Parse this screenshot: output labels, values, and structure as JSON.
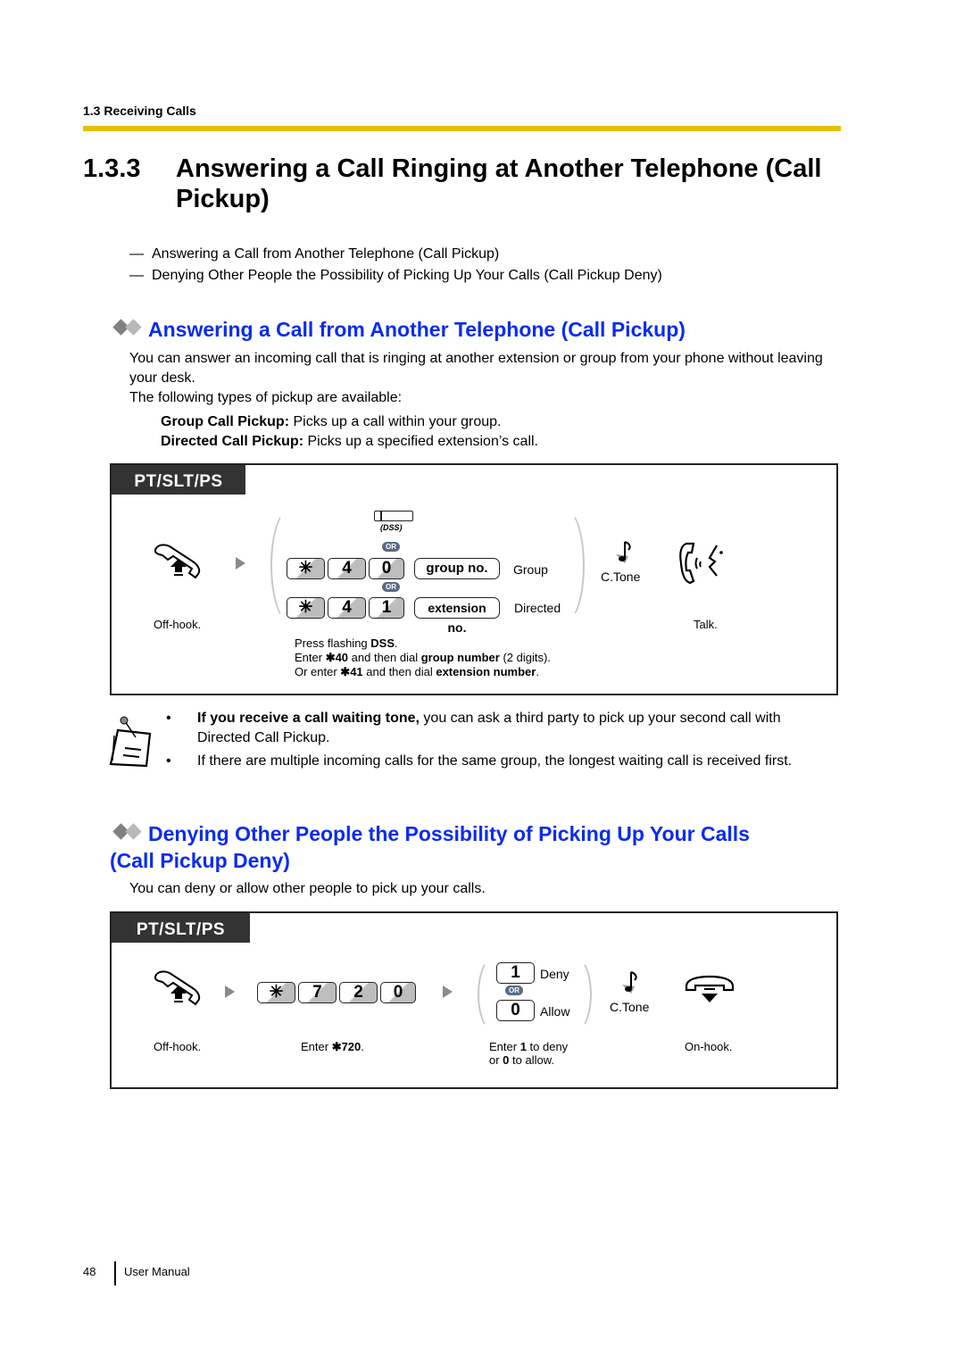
{
  "header": {
    "running_head": "1.3 Receiving Calls",
    "rule_color": "#e6c000"
  },
  "title": {
    "number": "1.3.3",
    "text": "Answering a Call Ringing at Another Telephone (Call Pickup)"
  },
  "toc": [
    "Answering a Call from Another Telephone (Call Pickup)",
    "Denying Other People the Possibility of Picking Up Your Calls (Call Pickup Deny)"
  ],
  "dash": "—",
  "heading_color": "#0a2cf0",
  "section1": {
    "heading": "Answering a Call from Another Telephone (Call Pickup)",
    "intro_1": "You can answer an incoming call that is ringing at another extension or group from your phone without leaving your desk.",
    "intro_2": "The following types of pickup are available:",
    "types": [
      {
        "term": "Group Call Pickup:",
        "desc": " Picks up a call within your group."
      },
      {
        "term": "Directed Call Pickup:",
        "desc": " Picks up a specified extension’s call."
      }
    ],
    "panel": {
      "tab": "PT/SLT/PS",
      "offhook_label": "Off-hook.",
      "dss_label": "(DSS)",
      "or": "OR",
      "row1_keys": [
        "✳",
        "4",
        "0"
      ],
      "row1_pill": "group no.",
      "row1_label": "Group",
      "row2_keys": [
        "✳",
        "4",
        "1"
      ],
      "row2_pill": "extension no.",
      "row2_label": "Directed",
      "ctone": "C.Tone",
      "talk": "Talk.",
      "instructions": {
        "line1_pre": "Press flashing ",
        "line1_bold": "DSS",
        "line1_post": ".",
        "line2_pre": "Enter ",
        "line2_code": "✱40",
        "line2_mid": " and then dial ",
        "line2_bold": "group number",
        "line2_post": " (2 digits).",
        "line3_pre": "Or enter ",
        "line3_code": "✱41",
        "line3_mid": " and then dial ",
        "line3_bold": "extension number",
        "line3_post": "."
      }
    },
    "notes": [
      {
        "bold": "If you receive a call waiting tone,",
        "text": " you can ask a third party to pick up your second call with Directed Call Pickup."
      },
      {
        "bold": "",
        "text": "If there are multiple incoming calls for the same group, the longest waiting call is received first."
      }
    ],
    "bullet": "•"
  },
  "section2": {
    "heading_line1": "Denying Other People the Possibility of Picking Up Your Calls",
    "heading_line2": "(Call Pickup Deny)",
    "intro": "You can deny or allow other people to pick up your calls.",
    "panel": {
      "tab": "PT/SLT/PS",
      "offhook_label": "Off-hook.",
      "keys": [
        "✳",
        "7",
        "2",
        "0"
      ],
      "enter_pre": "Enter ",
      "enter_code": "✱720",
      "enter_post": ".",
      "option1_key": "1",
      "option1_label": "Deny",
      "option2_key": "0",
      "option2_label": "Allow",
      "or": "OR",
      "choice_line1_pre": "Enter ",
      "choice_line1_bold": "1",
      "choice_line1_post": " to deny",
      "choice_line2_pre": "or ",
      "choice_line2_bold": "0",
      "choice_line2_post": " to allow.",
      "ctone": "C.Tone",
      "onhook_label": "On-hook."
    }
  },
  "footer": {
    "page_number": "48",
    "label": "User Manual"
  }
}
